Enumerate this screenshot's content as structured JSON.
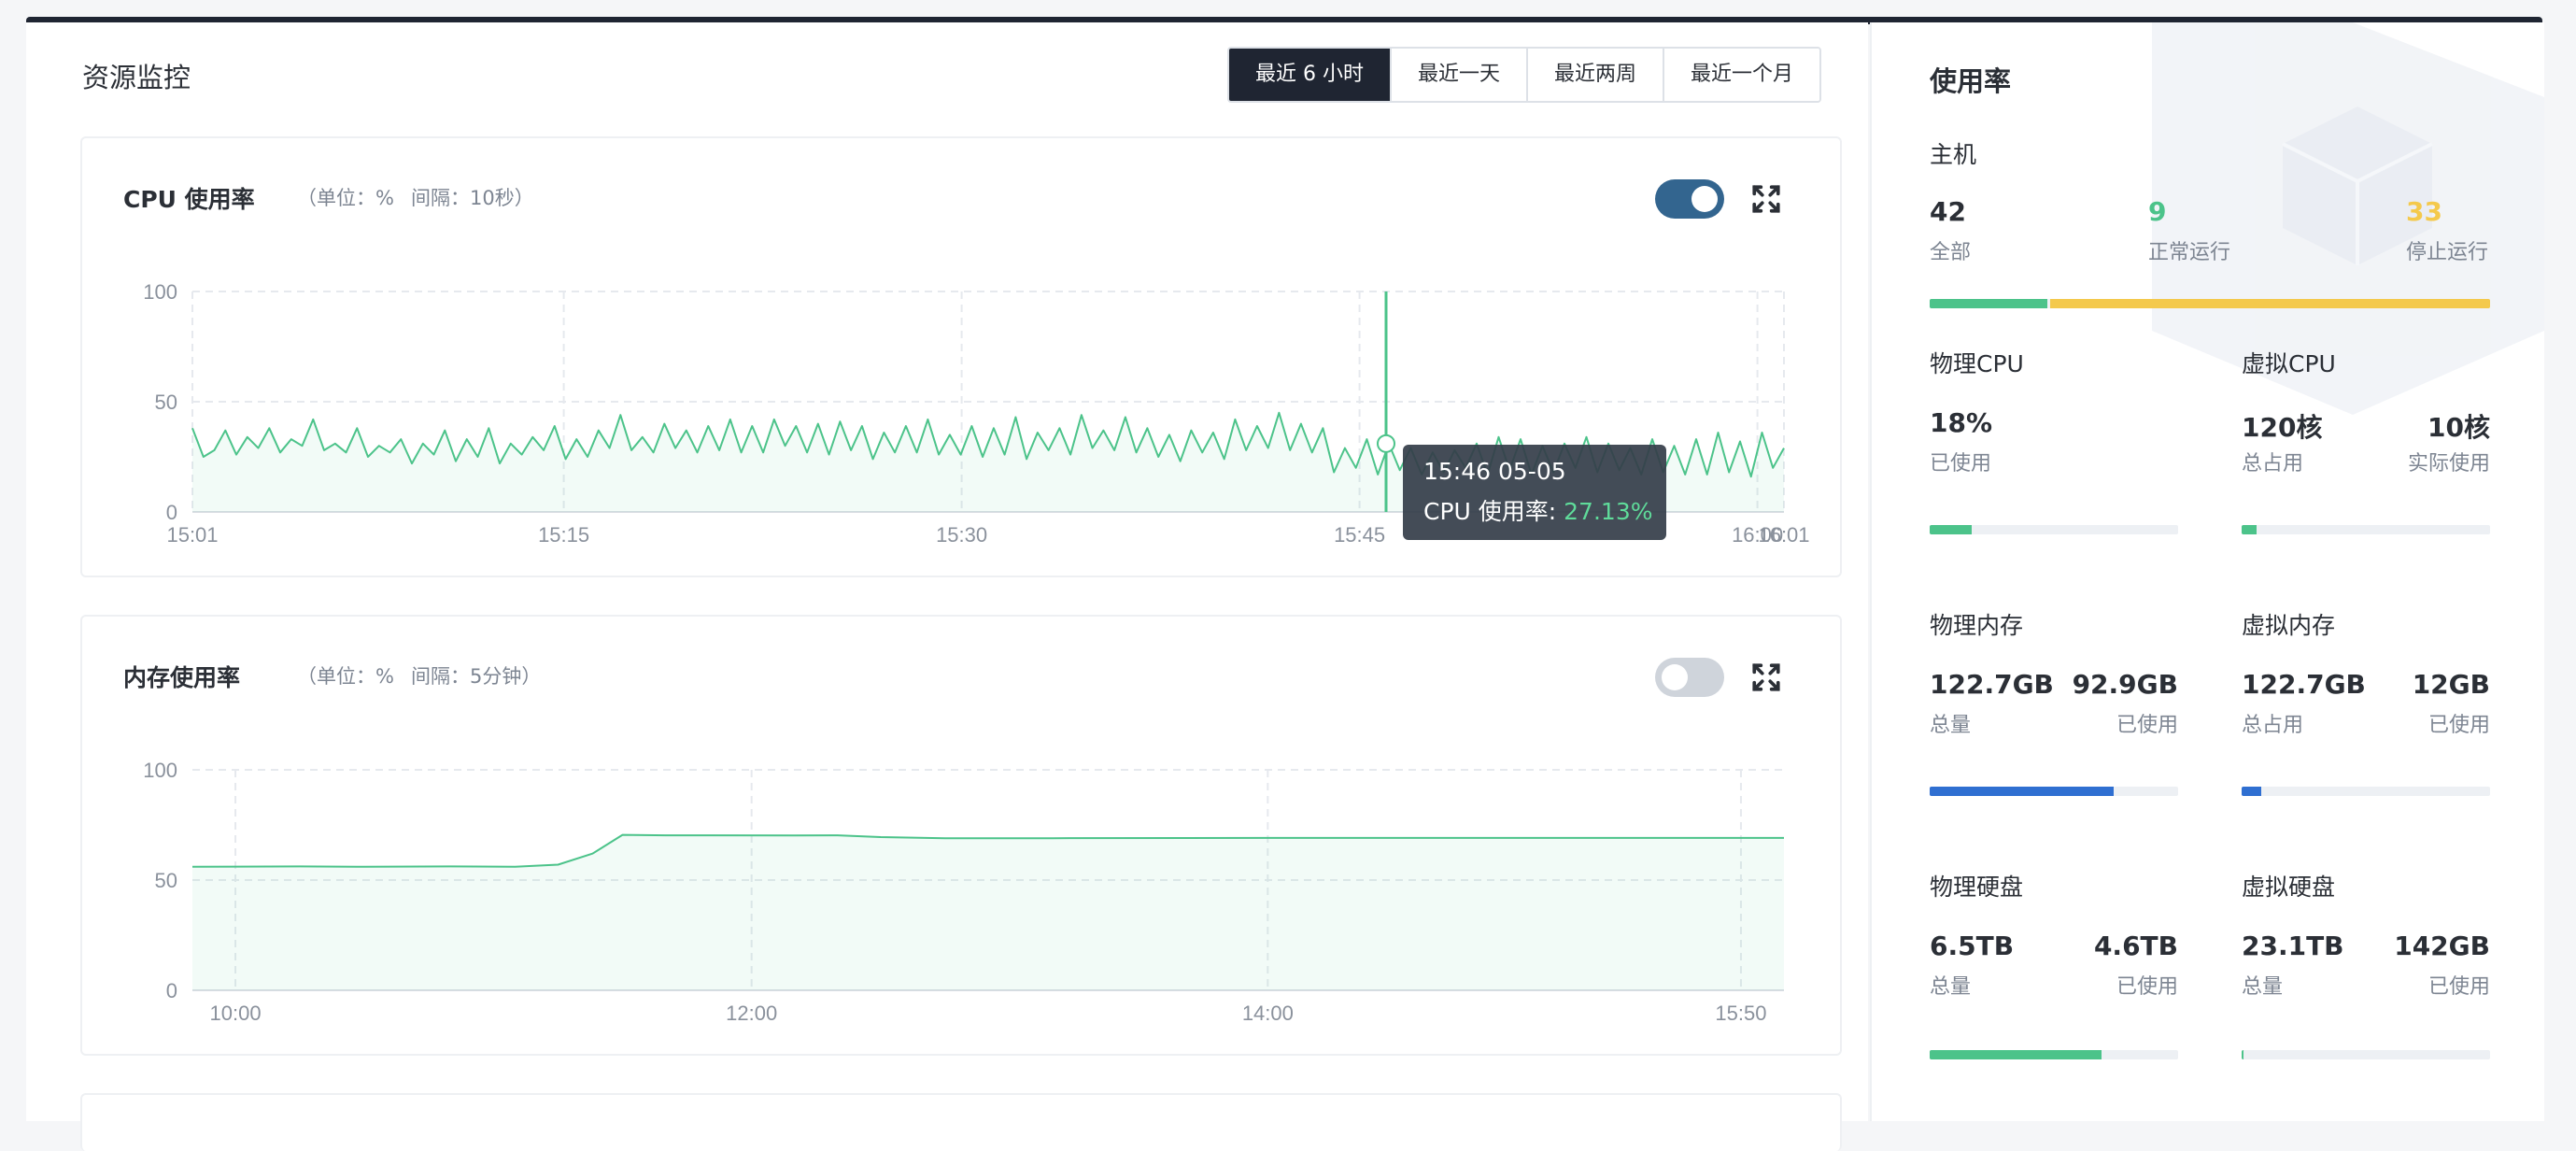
{
  "page": {
    "title": "资源监控",
    "ranges": [
      "最近 6 小时",
      "最近一天",
      "最近两周",
      "最近一个月"
    ],
    "active_range": "最近 6 小时"
  },
  "cpu_chart": {
    "title": "CPU 使用率",
    "unit_label": "（单位：%",
    "interval_label": "间隔：10秒）",
    "toggle_on": true,
    "tooltip": {
      "time": "15:46 05-05",
      "label": "CPU 使用率: ",
      "value": "27.13%"
    }
  },
  "mem_chart": {
    "title": "内存使用率",
    "unit_label": "（单位：%",
    "interval_label": "间隔：5分钟）",
    "toggle_on": false
  },
  "chart_data": [
    {
      "type": "line",
      "title": "CPU 使用率",
      "ylim": [
        0,
        100
      ],
      "y_ticks": [
        "100",
        "50",
        "0"
      ],
      "x_ticks": [
        "15:01",
        "15:15",
        "15:30",
        "15:45",
        "16:00",
        "16:01"
      ],
      "x_range_minutes": [
        0,
        60
      ],
      "x_tick_minutes": [
        0,
        14,
        29,
        44,
        59,
        60
      ],
      "highlight_minute": 45,
      "series": [
        {
          "color": "#4cc38a",
          "values": [
            38,
            25,
            28,
            37,
            26,
            34,
            29,
            38,
            27,
            33,
            30,
            42,
            28,
            31,
            27,
            38,
            25,
            30,
            27,
            33,
            22,
            31,
            26,
            37,
            23,
            33,
            25,
            38,
            22,
            31,
            26,
            34,
            28,
            39,
            24,
            33,
            25,
            37,
            29,
            44,
            28,
            34,
            27,
            40,
            29,
            37,
            27,
            39,
            28,
            42,
            27,
            39,
            27,
            42,
            30,
            39,
            27,
            40,
            26,
            41,
            28,
            39,
            24,
            36,
            27,
            39,
            27,
            42,
            26,
            35,
            26,
            39,
            25,
            38,
            26,
            43,
            24,
            36,
            28,
            38,
            26,
            44,
            29,
            37,
            28,
            43,
            27,
            38,
            25,
            35,
            23,
            37,
            27,
            36,
            24,
            42,
            28,
            39,
            29,
            45,
            28,
            40,
            27,
            38,
            18,
            29,
            20,
            33,
            17,
            31,
            19,
            29,
            17,
            27,
            18,
            28,
            20,
            31,
            17,
            34,
            19,
            33,
            17,
            30,
            18,
            31,
            20,
            34,
            18,
            31,
            19,
            29,
            17,
            33,
            18,
            30,
            17,
            33,
            17,
            36,
            18,
            32,
            16,
            36,
            20,
            29
          ]
        }
      ]
    },
    {
      "type": "area",
      "title": "内存使用率",
      "ylim": [
        0,
        100
      ],
      "y_ticks": [
        "100",
        "50",
        "0"
      ],
      "x_ticks": [
        "10:00",
        "12:00",
        "14:00",
        "15:50"
      ],
      "x_range_minutes": [
        0,
        370
      ],
      "x_tick_minutes": [
        10,
        130,
        250,
        360
      ],
      "series": [
        {
          "color": "#4cc38a",
          "points": [
            [
              0,
              56
            ],
            [
              25,
              56.2
            ],
            [
              40,
              56
            ],
            [
              60,
              56.2
            ],
            [
              75,
              56
            ],
            [
              85,
              57
            ],
            [
              93,
              62
            ],
            [
              100,
              70.5
            ],
            [
              110,
              70.3
            ],
            [
              140,
              70.2
            ],
            [
              150,
              70.3
            ],
            [
              160,
              69.5
            ],
            [
              175,
              69
            ],
            [
              200,
              69
            ],
            [
              250,
              69.1
            ],
            [
              300,
              69.1
            ],
            [
              370,
              69.1
            ]
          ]
        }
      ]
    }
  ],
  "usage": {
    "title": "使用率",
    "hosts": {
      "heading": "主机",
      "total": "42",
      "total_label": "全部",
      "running": "9",
      "running_label": "正常运行",
      "stopped": "33",
      "stopped_label": "停止运行",
      "running_fraction": 0.21,
      "running_color": "#4cc38a",
      "stopped_color": "#f4c94c"
    },
    "physical_cpu": {
      "heading": "物理CPU",
      "value": "18%",
      "label": "已使用",
      "fraction": 0.17,
      "color": "#4cc38a"
    },
    "virtual_cpu": {
      "heading": "虚拟CPU",
      "total": "120核",
      "total_label": "总占用",
      "actual": "10核",
      "actual_label": "实际使用",
      "fraction": 0.06,
      "color": "#4cc38a"
    },
    "physical_memory": {
      "heading": "物理内存",
      "total": "122.7GB",
      "total_label": "总量",
      "used": "92.9GB",
      "used_label": "已使用",
      "fraction": 0.74,
      "color": "#2f6fd1"
    },
    "virtual_memory": {
      "heading": "虚拟内存",
      "total": "122.7GB",
      "total_label": "总占用",
      "used": "12GB",
      "used_label": "已使用",
      "fraction": 0.08,
      "color": "#2f6fd1"
    },
    "physical_disk": {
      "heading": "物理硬盘",
      "total": "6.5TB",
      "total_label": "总量",
      "used": "4.6TB",
      "used_label": "已使用",
      "fraction": 0.69,
      "color": "#4cc38a"
    },
    "virtual_disk": {
      "heading": "虚拟硬盘",
      "total": "23.1TB",
      "total_label": "总量",
      "used": "142GB",
      "used_label": "已使用",
      "fraction": 0.006,
      "color": "#4cc38a"
    }
  }
}
